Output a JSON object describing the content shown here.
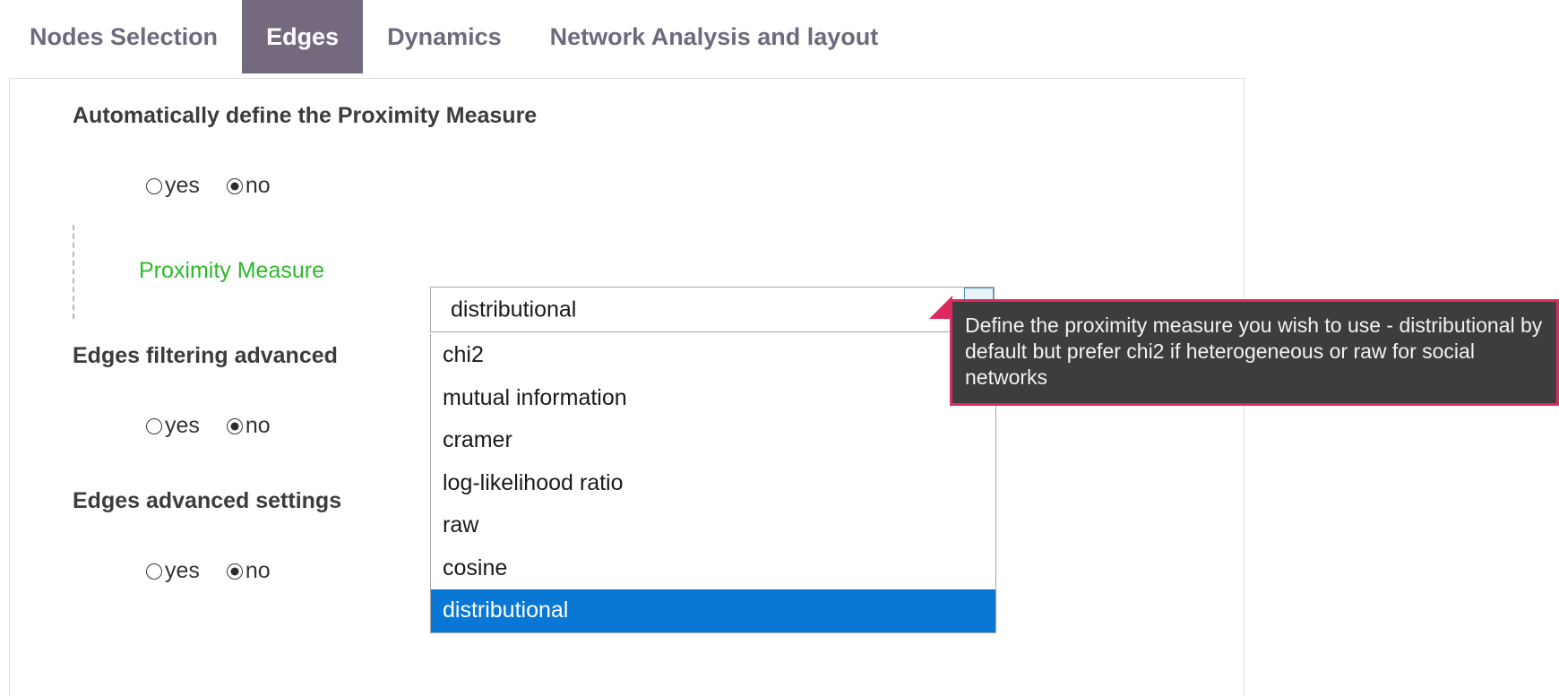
{
  "tabs": [
    {
      "label": "Nodes Selection",
      "active": false
    },
    {
      "label": "Edges",
      "active": true
    },
    {
      "label": "Dynamics",
      "active": false
    },
    {
      "label": "Network Analysis and layout",
      "active": false
    }
  ],
  "sections": {
    "auto_define": {
      "title": "Automatically define the Proximity Measure",
      "options": [
        {
          "label": "yes",
          "checked": false
        },
        {
          "label": "no",
          "checked": true
        }
      ]
    },
    "edges_filtering": {
      "title": "Edges filtering advanced",
      "options": [
        {
          "label": "yes",
          "checked": false
        },
        {
          "label": "no",
          "checked": true
        }
      ]
    },
    "edges_advanced": {
      "title": "Edges advanced settings",
      "options": [
        {
          "label": "yes",
          "checked": false
        },
        {
          "label": "no",
          "checked": true
        }
      ]
    }
  },
  "proximity_measure": {
    "label": "Proximity Measure",
    "label_color": "#2eb82e",
    "selected_value": "distributional",
    "expanded": true,
    "options": [
      "chi2",
      "mutual information",
      "cramer",
      "log-likelihood ratio",
      "raw",
      "cosine",
      "distributional"
    ],
    "selected_index": 6,
    "highlight_color": "#0878d4"
  },
  "tooltip": {
    "text": "Define the proximity measure you wish to use - distributional by default but prefer chi2 if heterogeneous or raw for social networks",
    "background_color": "#3d3d3d",
    "border_color": "#dd2a5e"
  },
  "theme": {
    "active_tab_background": "#74697e",
    "tab_text_color": "#6e6a7d",
    "panel_border_color": "#dedede"
  }
}
